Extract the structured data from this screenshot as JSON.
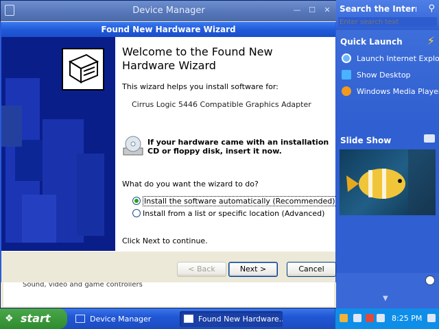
{
  "device_manager": {
    "title": "Device Manager",
    "tree_item_partial": "Sound, video and game controllers"
  },
  "wizard": {
    "title": "Found New Hardware Wizard",
    "heading": "Welcome to the Found New Hardware Wizard",
    "intro": "This wizard helps you install software for:",
    "device": "Cirrus Logic 5446 Compatible Graphics Adapter",
    "cd_notice": "If your hardware came with an installation CD or floppy disk, insert it now.",
    "question": "What do you want the wizard to do?",
    "options": [
      {
        "label": "Install the software automatically (Recommended)",
        "selected": true
      },
      {
        "label": "Install from a list or specific location (Advanced)",
        "selected": false
      }
    ],
    "continue_text": "Click Next to continue.",
    "buttons": {
      "back": "< Back",
      "next": "Next >",
      "cancel": "Cancel"
    }
  },
  "sidebar": {
    "search_title": "Search the Internet",
    "search_placeholder": "Enter search text",
    "quick_launch_title": "Quick Launch",
    "quick_launch_items": [
      "Launch Internet Explorer",
      "Show Desktop",
      "Windows Media Player"
    ],
    "slideshow_title": "Slide Show"
  },
  "taskbar": {
    "start_label": "start",
    "tasks": [
      {
        "label": "Device Manager",
        "active": false
      },
      {
        "label": "Found New Hardware...",
        "active": true
      }
    ],
    "clock": "8:25 PM"
  },
  "colors": {
    "titlebar_active": "#2058d8",
    "wizard_side_panel": "#0a1e8a",
    "sidebar_bg": "#2f5fd0",
    "taskbar": "#2157d5",
    "start_button": "#3c9a3c"
  }
}
